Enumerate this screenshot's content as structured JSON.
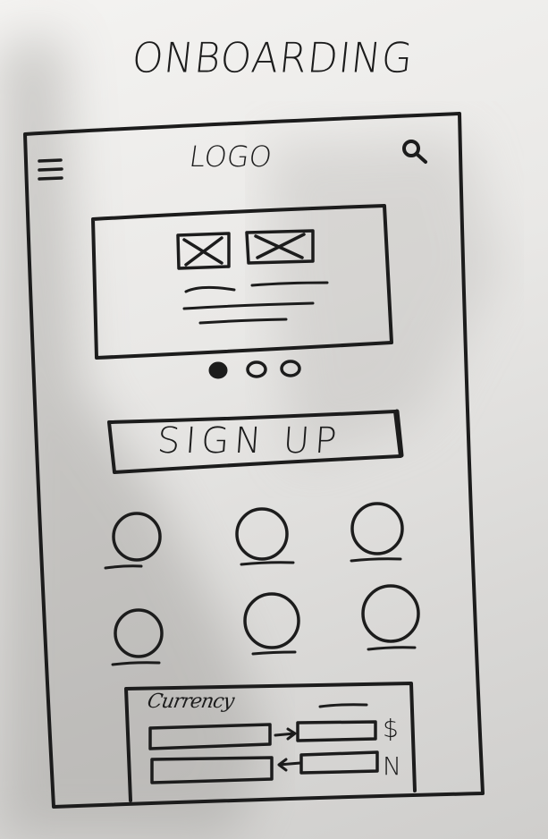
{
  "page": {
    "title": "ONBOARDING"
  },
  "header": {
    "menu_icon": "hamburger-menu-icon",
    "logo_text": "LOGO",
    "search_icon": "search-icon"
  },
  "carousel": {
    "slide_images": [
      "image-placeholder-icon",
      "image-placeholder-icon"
    ],
    "pager_count": 3,
    "active_page": 1
  },
  "signup": {
    "label": "SIGN UP"
  },
  "grid": {
    "item_count": 6
  },
  "currency_widget": {
    "label": "Currency",
    "rows": [
      {
        "arrow_icon": "arrow-right-icon",
        "symbol": "$"
      },
      {
        "arrow_icon": "arrow-left-icon",
        "symbol": "N"
      }
    ]
  },
  "colors": {
    "ink": "#1c1c1c",
    "paper": "#f1f0ee"
  }
}
